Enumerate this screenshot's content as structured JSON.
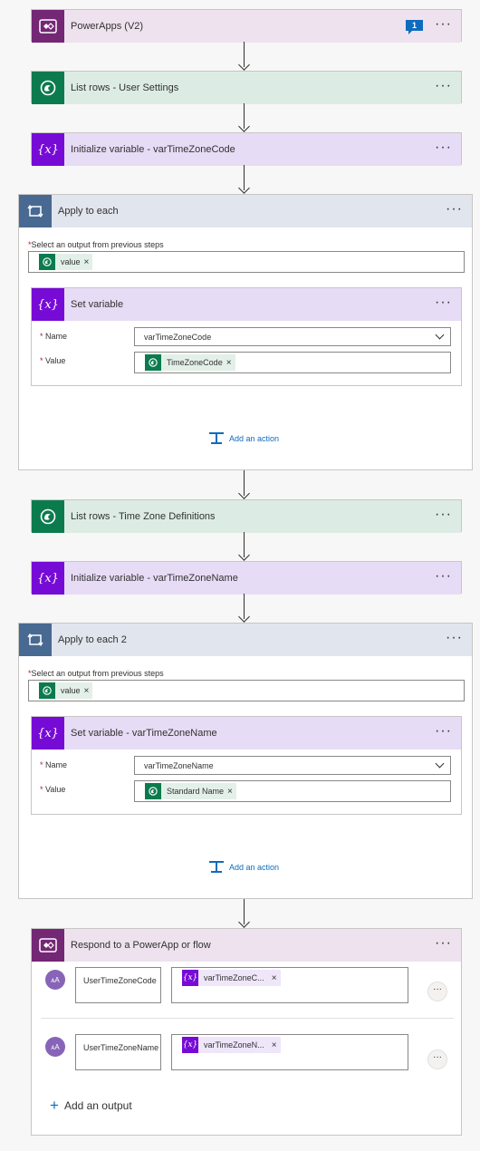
{
  "steps": {
    "trigger": {
      "title": "PowerApps (V2)",
      "comment_count": "1",
      "more": "···"
    },
    "list_user_settings": {
      "title": "List rows - User Settings",
      "more": "···"
    },
    "init_tz_code": {
      "title": "Initialize variable - varTimeZoneCode",
      "more": "···"
    },
    "apply_each": {
      "title": "Apply to each",
      "more": "···",
      "select_label": "Select an output from previous steps",
      "token": "value",
      "inner": {
        "title": "Set variable",
        "more": "···",
        "name_label": "Name",
        "name_value": "varTimeZoneCode",
        "value_label": "Value",
        "value_token": "TimeZoneCode"
      },
      "add_action": "Add an action"
    },
    "list_tz_defs": {
      "title": "List rows - Time Zone Definitions",
      "more": "···"
    },
    "init_tz_name": {
      "title": "Initialize variable - varTimeZoneName",
      "more": "···"
    },
    "apply_each_2": {
      "title": "Apply to each 2",
      "more": "···",
      "select_label": "Select an output from previous steps",
      "token": "value",
      "inner": {
        "title": "Set variable - varTimeZoneName",
        "more": "···",
        "name_label": "Name",
        "name_value": "varTimeZoneName",
        "value_label": "Value",
        "value_token": "Standard Name"
      },
      "add_action": "Add an action"
    },
    "respond": {
      "title": "Respond to a PowerApp or flow",
      "more": "···",
      "outputs": [
        {
          "avatar": "ᴀA",
          "name": "UserTimeZoneCode",
          "token": "varTimeZoneC...",
          "more": "···"
        },
        {
          "avatar": "ᴀA",
          "name": "UserTimeZoneName",
          "token": "varTimeZoneN...",
          "more": "···"
        }
      ],
      "add_output": "Add an output"
    }
  },
  "symbols": {
    "required": "*",
    "close": "×",
    "plus": "+",
    "fx": "{x}"
  },
  "colors": {
    "powerapps": "#742774",
    "dataverse": "#0b7b4e",
    "variable": "#770bd6",
    "loop": "#486991",
    "link": "#0f6cbd",
    "avatar": "#8764b8"
  },
  "icons": {
    "powerapps": "powerapps-icon",
    "dataverse": "dataverse-icon",
    "variable": "variable-icon",
    "loop": "loop-icon",
    "comment": "comment-icon"
  }
}
